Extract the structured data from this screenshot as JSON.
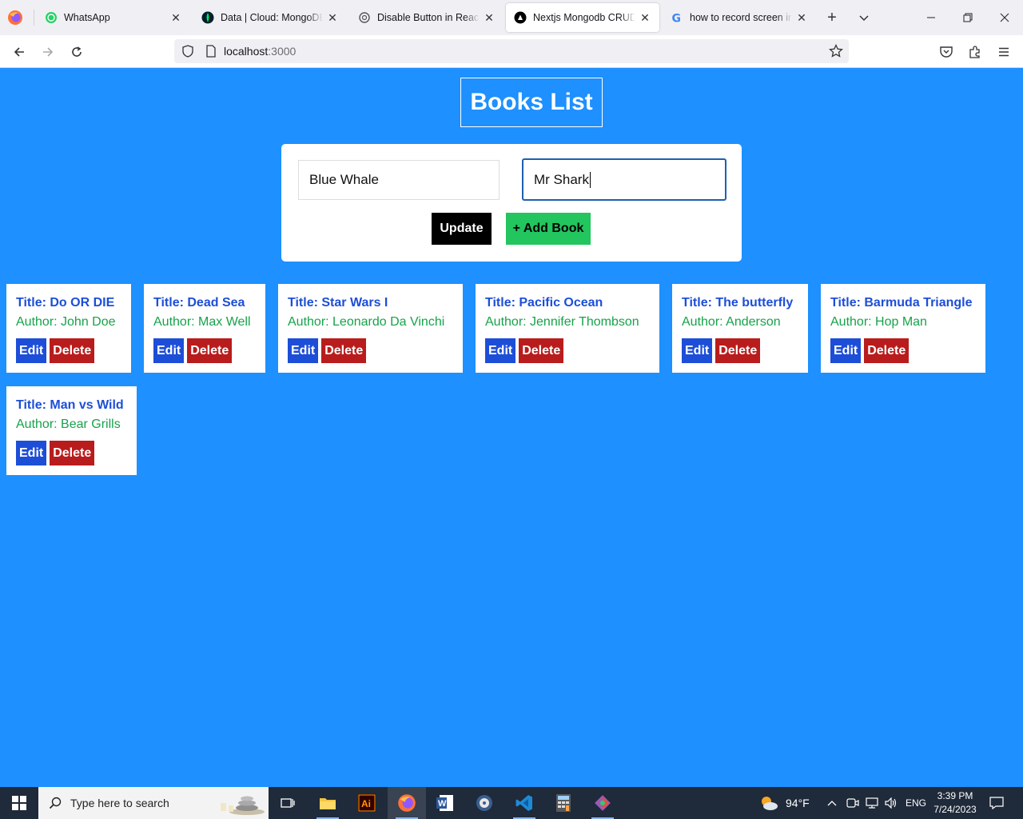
{
  "browser": {
    "tabs": [
      {
        "label": "WhatsApp",
        "icon": "whatsapp-icon",
        "active": false
      },
      {
        "label": "Data | Cloud: MongoDB Cloud",
        "icon": "mongodb-icon",
        "active": false
      },
      {
        "label": "Disable Button in ReactJS.",
        "icon": "chatgpt-icon",
        "active": false
      },
      {
        "label": "Nextjs Mongodb CRUD app",
        "icon": "nextjs-icon",
        "active": true
      },
      {
        "label": "how to record screen in windows",
        "icon": "google-icon",
        "active": false
      }
    ],
    "url_host": "localhost",
    "url_port": ":3000"
  },
  "page": {
    "heading": "Books List",
    "form": {
      "title_value": "Blue Whale",
      "author_value": "Mr Shark",
      "update_label": "Update",
      "add_label": "+ Add Book"
    },
    "books": [
      {
        "title": "Title: Do OR DIE",
        "author": "Author: John Doe",
        "edit": "Edit",
        "delete": "Delete"
      },
      {
        "title": "Title: Dead Sea",
        "author": "Author: Max Well",
        "edit": "Edit",
        "delete": "Delete"
      },
      {
        "title": "Title: Star Wars I",
        "author": "Author: Leonardo Da Vinchi",
        "edit": "Edit",
        "delete": "Delete"
      },
      {
        "title": "Title: Pacific Ocean",
        "author": "Author: Jennifer Thombson",
        "edit": "Edit",
        "delete": "Delete"
      },
      {
        "title": "Title: The butterfly",
        "author": "Author: Anderson",
        "edit": "Edit",
        "delete": "Delete"
      },
      {
        "title": "Title: Barmuda Triangle",
        "author": "Author: Hop Man",
        "edit": "Edit",
        "delete": "Delete"
      },
      {
        "title": "Title: Man vs Wild",
        "author": "Author: Bear Grills",
        "edit": "Edit",
        "delete": "Delete"
      }
    ]
  },
  "taskbar": {
    "search_placeholder": "Type here to search",
    "weather": "94°F",
    "language": "ENG",
    "time": "3:39 PM",
    "date": "7/24/2023"
  },
  "colors": {
    "page_bg": "#1e90ff",
    "title_blue": "#1d4ed8",
    "author_green": "#16a34a",
    "edit_bg": "#1d4ed8",
    "delete_bg": "#b91c1c",
    "add_bg": "#22c55e"
  }
}
